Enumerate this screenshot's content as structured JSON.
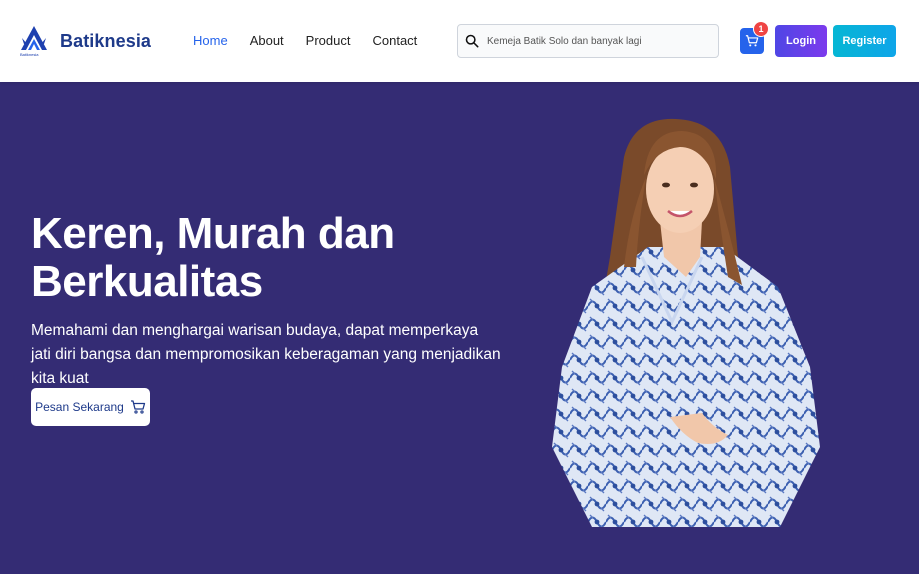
{
  "brand": {
    "name": "Batiknesia",
    "logo_small": "Batiknesia",
    "logo_icon": "batik-logo-icon"
  },
  "nav": [
    {
      "label": "Home",
      "active": true
    },
    {
      "label": "About",
      "active": false
    },
    {
      "label": "Product",
      "active": false
    },
    {
      "label": "Contact",
      "active": false
    }
  ],
  "search": {
    "placeholder": "Kemeja Batik Solo dan banyak lagi",
    "value": "",
    "icon": "search-icon"
  },
  "cart": {
    "count": "1",
    "icon": "cart-icon"
  },
  "auth": {
    "login_label": "Login",
    "register_label": "Register"
  },
  "hero": {
    "title": "Keren, Murah dan Berkualitas",
    "subtitle": "Memahami dan menghargai warisan budaya, dapat memperkaya jati diri bangsa dan mempromosikan keberagaman yang menjadikan kita kuat",
    "cta_label": "Pesan Sekarang",
    "cta_icon": "cart-icon"
  },
  "colors": {
    "hero_bg": "#342c74",
    "brand": "#1e3a8a",
    "nav_active": "#2563eb",
    "login_bg": "#6d28d9",
    "register_bg": "#0ea5e9",
    "badge": "#ef4444"
  }
}
